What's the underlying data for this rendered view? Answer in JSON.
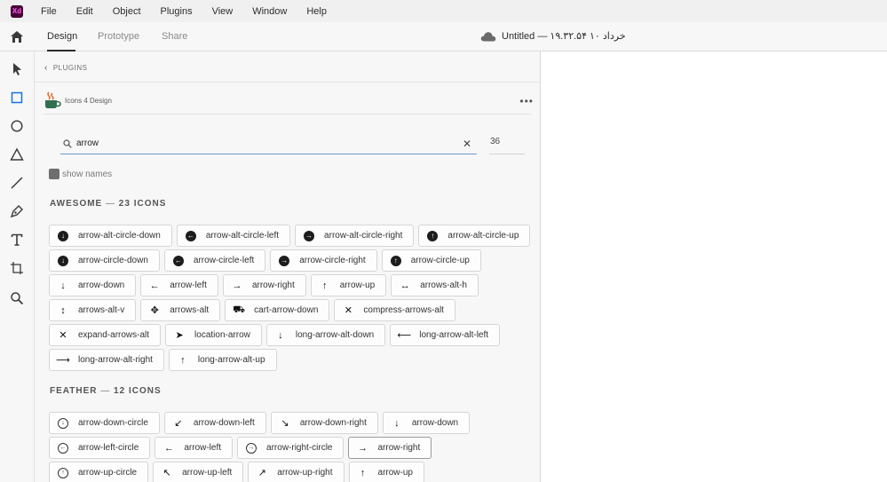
{
  "menubar": {
    "logo": "Xd",
    "items": [
      "File",
      "Edit",
      "Object",
      "Plugins",
      "View",
      "Window",
      "Help"
    ]
  },
  "toolbar": {
    "tabs": [
      "Design",
      "Prototype",
      "Share"
    ],
    "document_title": "Untitled — ۱۹.۳۲.۵۴ ۱۰ خرداد"
  },
  "panel": {
    "breadcrumb": "PLUGINS",
    "plugin_name": "Icons 4 Design",
    "search": {
      "value": "arrow"
    },
    "size": "36",
    "show_names_label": "show names",
    "sections": [
      {
        "name": "AWESOME",
        "separator": " — ",
        "count_label": "23 ICONS",
        "icons": [
          {
            "label": "arrow-alt-circle-down",
            "glyph": "↓",
            "style": "filled"
          },
          {
            "label": "arrow-alt-circle-left",
            "glyph": "←",
            "style": "filled"
          },
          {
            "label": "arrow-alt-circle-right",
            "glyph": "→",
            "style": "filled"
          },
          {
            "label": "arrow-alt-circle-up",
            "glyph": "↑",
            "style": "filled"
          },
          {
            "label": "arrow-circle-down",
            "glyph": "↓",
            "style": "filled"
          },
          {
            "label": "arrow-circle-left",
            "glyph": "←",
            "style": "filled"
          },
          {
            "label": "arrow-circle-right",
            "glyph": "→",
            "style": "filled"
          },
          {
            "label": "arrow-circle-up",
            "glyph": "↑",
            "style": "filled"
          },
          {
            "label": "arrow-down",
            "glyph": "↓",
            "style": "plain"
          },
          {
            "label": "arrow-left",
            "glyph": "←",
            "style": "plain"
          },
          {
            "label": "arrow-right",
            "glyph": "→",
            "style": "plain"
          },
          {
            "label": "arrow-up",
            "glyph": "↑",
            "style": "plain"
          },
          {
            "label": "arrows-alt-h",
            "glyph": "↔",
            "style": "plain"
          },
          {
            "label": "arrows-alt-v",
            "glyph": "↕",
            "style": "plain"
          },
          {
            "label": "arrows-alt",
            "glyph": "✥",
            "style": "plain"
          },
          {
            "label": "cart-arrow-down",
            "glyph": "⛟",
            "style": "plain"
          },
          {
            "label": "compress-arrows-alt",
            "glyph": "✕",
            "style": "plain"
          },
          {
            "label": "expand-arrows-alt",
            "glyph": "✕",
            "style": "plain"
          },
          {
            "label": "location-arrow",
            "glyph": "➤",
            "style": "plain"
          },
          {
            "label": "long-arrow-alt-down",
            "glyph": "↓",
            "style": "plain"
          },
          {
            "label": "long-arrow-alt-left",
            "glyph": "⟵",
            "style": "plain"
          },
          {
            "label": "long-arrow-alt-right",
            "glyph": "⟶",
            "style": "plain"
          },
          {
            "label": "long-arrow-alt-up",
            "glyph": "↑",
            "style": "plain"
          }
        ]
      },
      {
        "name": "FEATHER",
        "separator": " — ",
        "count_label": "12 ICONS",
        "icons": [
          {
            "label": "arrow-down-circle",
            "glyph": "↓",
            "style": "outline"
          },
          {
            "label": "arrow-down-left",
            "glyph": "↙",
            "style": "plain"
          },
          {
            "label": "arrow-down-right",
            "glyph": "↘",
            "style": "plain"
          },
          {
            "label": "arrow-down",
            "glyph": "↓",
            "style": "plain"
          },
          {
            "label": "arrow-left-circle",
            "glyph": "←",
            "style": "outline"
          },
          {
            "label": "arrow-left",
            "glyph": "←",
            "style": "plain"
          },
          {
            "label": "arrow-right-circle",
            "glyph": "→",
            "style": "outline"
          },
          {
            "label": "arrow-right",
            "glyph": "→",
            "style": "plain",
            "selected": true
          },
          {
            "label": "arrow-up-circle",
            "glyph": "↑",
            "style": "outline"
          },
          {
            "label": "arrow-up-left",
            "glyph": "↖",
            "style": "plain"
          },
          {
            "label": "arrow-up-right",
            "glyph": "↗",
            "style": "plain"
          },
          {
            "label": "arrow-up",
            "glyph": "↑",
            "style": "plain"
          }
        ]
      }
    ]
  }
}
